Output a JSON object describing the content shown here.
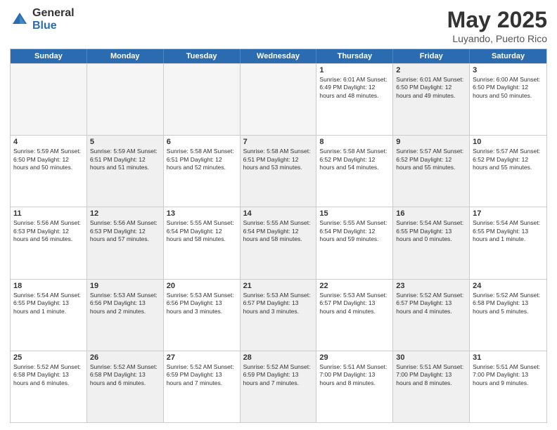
{
  "header": {
    "logo_general": "General",
    "logo_blue": "Blue",
    "month_title": "May 2025",
    "location": "Luyando, Puerto Rico"
  },
  "weekdays": [
    "Sunday",
    "Monday",
    "Tuesday",
    "Wednesday",
    "Thursday",
    "Friday",
    "Saturday"
  ],
  "rows": [
    [
      {
        "num": "",
        "info": "",
        "empty": true
      },
      {
        "num": "",
        "info": "",
        "empty": true
      },
      {
        "num": "",
        "info": "",
        "empty": true
      },
      {
        "num": "",
        "info": "",
        "empty": true
      },
      {
        "num": "1",
        "info": "Sunrise: 6:01 AM\nSunset: 6:49 PM\nDaylight: 12 hours\nand 48 minutes.",
        "empty": false
      },
      {
        "num": "2",
        "info": "Sunrise: 6:01 AM\nSunset: 6:50 PM\nDaylight: 12 hours\nand 49 minutes.",
        "empty": false,
        "shaded": true
      },
      {
        "num": "3",
        "info": "Sunrise: 6:00 AM\nSunset: 6:50 PM\nDaylight: 12 hours\nand 50 minutes.",
        "empty": false
      }
    ],
    [
      {
        "num": "4",
        "info": "Sunrise: 5:59 AM\nSunset: 6:50 PM\nDaylight: 12 hours\nand 50 minutes.",
        "empty": false
      },
      {
        "num": "5",
        "info": "Sunrise: 5:59 AM\nSunset: 6:51 PM\nDaylight: 12 hours\nand 51 minutes.",
        "empty": false,
        "shaded": true
      },
      {
        "num": "6",
        "info": "Sunrise: 5:58 AM\nSunset: 6:51 PM\nDaylight: 12 hours\nand 52 minutes.",
        "empty": false
      },
      {
        "num": "7",
        "info": "Sunrise: 5:58 AM\nSunset: 6:51 PM\nDaylight: 12 hours\nand 53 minutes.",
        "empty": false,
        "shaded": true
      },
      {
        "num": "8",
        "info": "Sunrise: 5:58 AM\nSunset: 6:52 PM\nDaylight: 12 hours\nand 54 minutes.",
        "empty": false
      },
      {
        "num": "9",
        "info": "Sunrise: 5:57 AM\nSunset: 6:52 PM\nDaylight: 12 hours\nand 55 minutes.",
        "empty": false,
        "shaded": true
      },
      {
        "num": "10",
        "info": "Sunrise: 5:57 AM\nSunset: 6:52 PM\nDaylight: 12 hours\nand 55 minutes.",
        "empty": false
      }
    ],
    [
      {
        "num": "11",
        "info": "Sunrise: 5:56 AM\nSunset: 6:53 PM\nDaylight: 12 hours\nand 56 minutes.",
        "empty": false
      },
      {
        "num": "12",
        "info": "Sunrise: 5:56 AM\nSunset: 6:53 PM\nDaylight: 12 hours\nand 57 minutes.",
        "empty": false,
        "shaded": true
      },
      {
        "num": "13",
        "info": "Sunrise: 5:55 AM\nSunset: 6:54 PM\nDaylight: 12 hours\nand 58 minutes.",
        "empty": false
      },
      {
        "num": "14",
        "info": "Sunrise: 5:55 AM\nSunset: 6:54 PM\nDaylight: 12 hours\nand 58 minutes.",
        "empty": false,
        "shaded": true
      },
      {
        "num": "15",
        "info": "Sunrise: 5:55 AM\nSunset: 6:54 PM\nDaylight: 12 hours\nand 59 minutes.",
        "empty": false
      },
      {
        "num": "16",
        "info": "Sunrise: 5:54 AM\nSunset: 6:55 PM\nDaylight: 13 hours\nand 0 minutes.",
        "empty": false,
        "shaded": true
      },
      {
        "num": "17",
        "info": "Sunrise: 5:54 AM\nSunset: 6:55 PM\nDaylight: 13 hours\nand 1 minute.",
        "empty": false
      }
    ],
    [
      {
        "num": "18",
        "info": "Sunrise: 5:54 AM\nSunset: 6:55 PM\nDaylight: 13 hours\nand 1 minute.",
        "empty": false
      },
      {
        "num": "19",
        "info": "Sunrise: 5:53 AM\nSunset: 6:56 PM\nDaylight: 13 hours\nand 2 minutes.",
        "empty": false,
        "shaded": true
      },
      {
        "num": "20",
        "info": "Sunrise: 5:53 AM\nSunset: 6:56 PM\nDaylight: 13 hours\nand 3 minutes.",
        "empty": false
      },
      {
        "num": "21",
        "info": "Sunrise: 5:53 AM\nSunset: 6:57 PM\nDaylight: 13 hours\nand 3 minutes.",
        "empty": false,
        "shaded": true
      },
      {
        "num": "22",
        "info": "Sunrise: 5:53 AM\nSunset: 6:57 PM\nDaylight: 13 hours\nand 4 minutes.",
        "empty": false
      },
      {
        "num": "23",
        "info": "Sunrise: 5:52 AM\nSunset: 6:57 PM\nDaylight: 13 hours\nand 4 minutes.",
        "empty": false,
        "shaded": true
      },
      {
        "num": "24",
        "info": "Sunrise: 5:52 AM\nSunset: 6:58 PM\nDaylight: 13 hours\nand 5 minutes.",
        "empty": false
      }
    ],
    [
      {
        "num": "25",
        "info": "Sunrise: 5:52 AM\nSunset: 6:58 PM\nDaylight: 13 hours\nand 6 minutes.",
        "empty": false
      },
      {
        "num": "26",
        "info": "Sunrise: 5:52 AM\nSunset: 6:58 PM\nDaylight: 13 hours\nand 6 minutes.",
        "empty": false,
        "shaded": true
      },
      {
        "num": "27",
        "info": "Sunrise: 5:52 AM\nSunset: 6:59 PM\nDaylight: 13 hours\nand 7 minutes.",
        "empty": false
      },
      {
        "num": "28",
        "info": "Sunrise: 5:52 AM\nSunset: 6:59 PM\nDaylight: 13 hours\nand 7 minutes.",
        "empty": false,
        "shaded": true
      },
      {
        "num": "29",
        "info": "Sunrise: 5:51 AM\nSunset: 7:00 PM\nDaylight: 13 hours\nand 8 minutes.",
        "empty": false
      },
      {
        "num": "30",
        "info": "Sunrise: 5:51 AM\nSunset: 7:00 PM\nDaylight: 13 hours\nand 8 minutes.",
        "empty": false,
        "shaded": true
      },
      {
        "num": "31",
        "info": "Sunrise: 5:51 AM\nSunset: 7:00 PM\nDaylight: 13 hours\nand 9 minutes.",
        "empty": false
      }
    ]
  ]
}
